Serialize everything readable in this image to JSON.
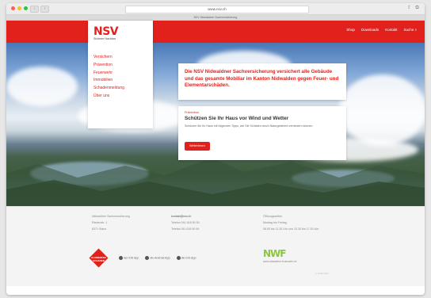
{
  "browser": {
    "url": "www.nsv.ch",
    "tab_title": "NSV Nidwaldner Sachversicherung",
    "dots": [
      "#ff5f57",
      "#febc2e",
      "#28c840"
    ]
  },
  "colors": {
    "brand_red": "#e2211c",
    "nwf_green": "#8cc53f"
  },
  "header": {
    "top_nav": [
      "Shop",
      "Downloads",
      "Kontakt",
      "Suche"
    ]
  },
  "logo": {
    "mark": "NSV",
    "tagline": "Sicherer Nachbar"
  },
  "menu": {
    "items": [
      "Versichern",
      "Prävention",
      "Feuerwehr",
      "Immobilien",
      "Schadenmeldung",
      "Über uns"
    ]
  },
  "hero": {
    "headline": "Die NSV Nidwaldner Sachversicherung versichert alle Gebäude und das gesamte Mobiliar im Kanton Nidwalden gegen Feuer- und Elementarschäden."
  },
  "article": {
    "kicker": "Prävention",
    "title": "Schützen Sie Ihr Haus vor Wind und Wetter",
    "body": "Schützen Sie Ihr Haus mit folgenden Tipps, wie Sie Schäden durch Naturgefahren verhindern können.",
    "button": "Weiterlesen"
  },
  "footer": {
    "address": [
      "Nidwaldner Sachversicherung",
      "Riedenstr. 1",
      "6371 Stans"
    ],
    "contact": [
      "kontakt@nsv.ch",
      "Telefon 041 618 50 50",
      "Telefax 041 618 50 59"
    ],
    "hours": [
      "Öffnungszeiten",
      "Montag bis Freitag",
      "08.00 bis 11.30 Uhr und 13.30 bis 17.00 Uhr"
    ],
    "badge_text": "ELEMENTAR SCHADEN",
    "apps": [
      "der iOS App",
      "die Android App",
      "die iOS App"
    ],
    "nwf_mark": "NWF",
    "nwf_caption": "www.nidwaldner-feuerwehr.ch",
    "copyright": "© 2015 NSV"
  }
}
